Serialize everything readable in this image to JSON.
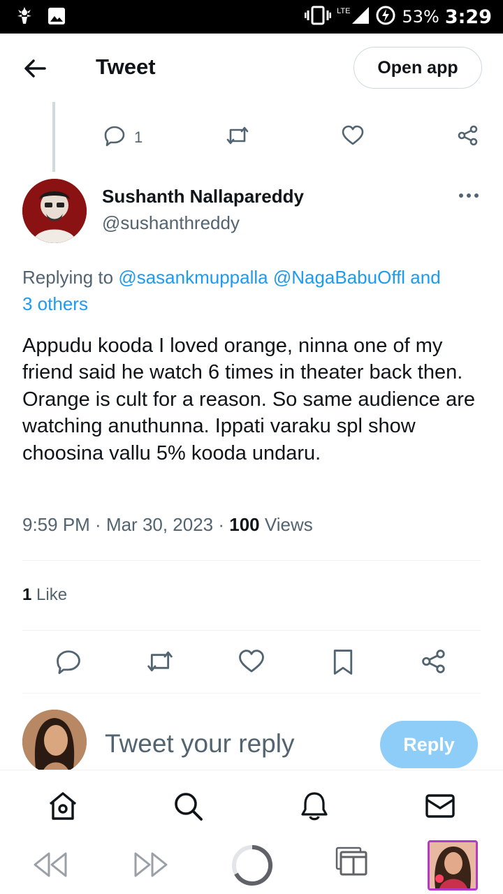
{
  "status_bar": {
    "battery": "53%",
    "time": "3:29",
    "network": "LTE",
    "icons": [
      "app-notification-icon",
      "gallery-icon",
      "vibrate-icon",
      "signal-icon",
      "battery-charging-icon"
    ]
  },
  "header": {
    "back_icon": "back-arrow-icon",
    "title": "Tweet",
    "open_app_label": "Open app"
  },
  "previous_tweet": {
    "reply_count": "1",
    "icons": [
      "reply-icon",
      "retweet-icon",
      "like-icon",
      "share-icon"
    ]
  },
  "tweet": {
    "author_name": "Sushanth Nallapareddy",
    "author_handle": "@sushanthreddy",
    "replying_prefix": "Replying to ",
    "replying_users": "@sasankmuppalla @NagaBabuOffl",
    "replying_and": " and",
    "replying_others": "3 others",
    "text": "Appudu kooda I loved orange, ninna one of my friend said he watch 6 times in theater back then. Orange is cult for a reason. So same audience are watching anuthunna. Ippati varaku spl show choosina vallu 5% kooda undaru.",
    "time": "9:59 PM",
    "date": "Mar 30, 2023",
    "views_count": "100",
    "views_label": " Views",
    "likes_count": "1",
    "likes_label": " Like"
  },
  "actions": [
    "reply-icon",
    "retweet-icon",
    "like-icon",
    "bookmark-icon",
    "share-icon"
  ],
  "reply_bar": {
    "placeholder": "Tweet your reply",
    "button_label": "Reply"
  },
  "bottom_nav": [
    "home-icon",
    "search-icon",
    "notifications-icon",
    "messages-icon"
  ],
  "browser_bar": [
    "back-icon",
    "forward-icon",
    "reload-icon",
    "tabs-icon",
    "tab-thumbnail"
  ],
  "colors": {
    "accent": "#1d9bf0",
    "reply_button": "#8ecdf7",
    "secondary_text": "#536471",
    "tab_border": "#b23bc7"
  }
}
